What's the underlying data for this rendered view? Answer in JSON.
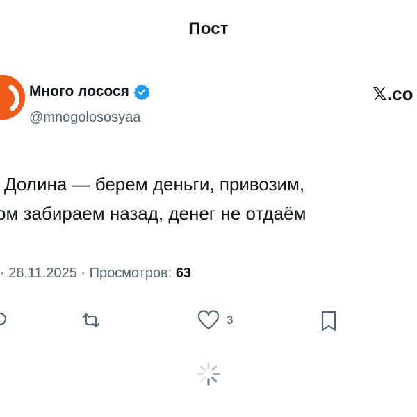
{
  "header": {
    "title": "Пост"
  },
  "author": {
    "name": "Много лосося",
    "handle": "@mnogolososyaa",
    "verified": true,
    "avatar_color": "#f05a1a"
  },
  "brand": {
    "label": "𝕏.co"
  },
  "tweet": {
    "line1": "Долина — берем деньги, привозим,",
    "line2": "ом забираем назад, денег не отдаём"
  },
  "meta": {
    "prefix": "· 28.11.2025 · Просмотров: ",
    "views": "63"
  },
  "actions": {
    "retweet_icon": "retweet-icon",
    "like_icon": "heart-icon",
    "like_count": "3",
    "bookmark_icon": "bookmark-icon"
  },
  "colors": {
    "text": "#0f1419",
    "muted": "#536471",
    "verified": "#1d9bf0"
  }
}
